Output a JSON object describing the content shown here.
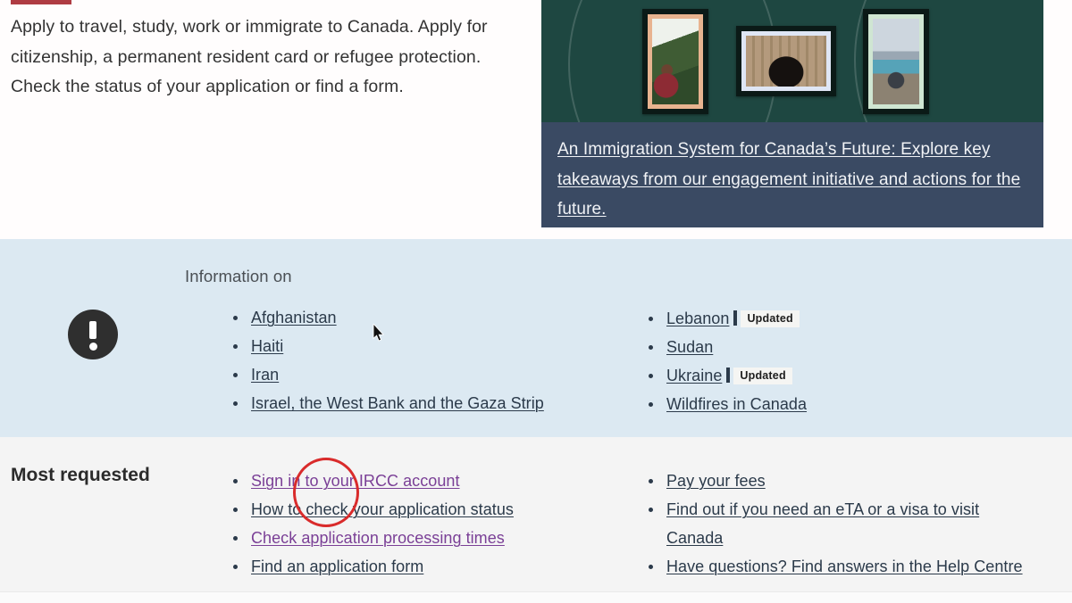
{
  "intro": {
    "paragraph": "Apply to travel, study, work or immigrate to Canada. Apply for citizenship, a permanent resident card or refugee protection. Check the status of your application or find a form."
  },
  "hero": {
    "caption_link": "An Immigration System for Canada’s Future: Explore key takeaways from our engagement initiative and actions for the future.",
    "background_color": "#1e4741",
    "caption_background_color": "#3a4a63",
    "photos": [
      {
        "name": "woman-in-red-reaching-up",
        "frame_color": "#e8b38f"
      },
      {
        "name": "woman-wearing-hijab-smiling",
        "frame_color": "#dfe6f5"
      },
      {
        "name": "person-arms-raised-at-mountain-lake",
        "frame_color": "#cfe6d2"
      }
    ]
  },
  "information_on": {
    "label": "Information on",
    "icon": "exclamation-circle-icon",
    "background_color": "#dce9f2",
    "left_column": [
      {
        "label": "Afghanistan",
        "badge": "",
        "visited": false
      },
      {
        "label": "Haiti",
        "badge": "",
        "visited": false
      },
      {
        "label": "Iran",
        "badge": "",
        "visited": false
      },
      {
        "label": "Israel, the West Bank and the Gaza Strip",
        "badge": "",
        "visited": false
      }
    ],
    "right_column": [
      {
        "label": "Lebanon",
        "badge": "Updated",
        "visited": false
      },
      {
        "label": "Sudan",
        "badge": "",
        "visited": false
      },
      {
        "label": "Ukraine",
        "badge": "Updated",
        "visited": false
      },
      {
        "label": "Wildfires in Canada",
        "badge": "",
        "visited": false
      }
    ]
  },
  "most_requested": {
    "title": "Most requested",
    "background_color": "#f4f4f4",
    "left_column": [
      {
        "label": "Sign in to your IRCC account",
        "visited": true
      },
      {
        "label": "How to check your application status",
        "visited": false
      },
      {
        "label": "Check application processing times",
        "visited": true
      },
      {
        "label": "Find an application form",
        "visited": false
      }
    ],
    "right_column": [
      {
        "label": "Pay your fees",
        "visited": false
      },
      {
        "label": "Find out if you need an eTA or a visa to visit Canada",
        "visited": false
      },
      {
        "label": "Have questions? Find answers in the Help Centre",
        "visited": false
      }
    ]
  },
  "annotations": {
    "highlight_circle_color": "#d92b2b",
    "highlight_target": "Sign in to your IRCC account",
    "accent_bar_color": "#af3c43"
  }
}
